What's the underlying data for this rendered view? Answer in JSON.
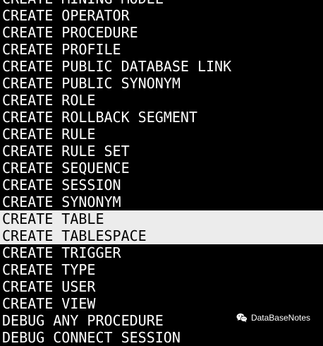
{
  "terminal": {
    "lines": [
      "CREATE MINING MODEL",
      "CREATE OPERATOR",
      "CREATE PROCEDURE",
      "CREATE PROFILE",
      "CREATE PUBLIC DATABASE LINK",
      "CREATE PUBLIC SYNONYM",
      "CREATE ROLE",
      "CREATE ROLLBACK SEGMENT",
      "CREATE RULE",
      "CREATE RULE SET",
      "CREATE SEQUENCE",
      "CREATE SESSION",
      "CREATE SYNONYM",
      "CREATE TABLE",
      "CREATE TABLESPACE",
      "CREATE TRIGGER",
      "CREATE TYPE",
      "CREATE USER",
      "CREATE VIEW",
      "DEBUG ANY PROCEDURE",
      "DEBUG CONNECT SESSION"
    ],
    "highlighted_lines": [
      13,
      14
    ],
    "colors": {
      "background": "#000000",
      "text": "#ffffff",
      "highlight_bg": "#ececec",
      "highlight_text": "#000000"
    }
  },
  "watermark": {
    "icon": "wechat-icon",
    "text": "DataBaseNotes"
  }
}
